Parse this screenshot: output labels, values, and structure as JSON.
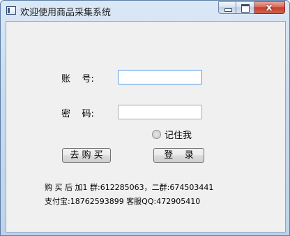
{
  "window": {
    "title": "欢迎使用商品采集系统",
    "close_glyph": "x"
  },
  "form": {
    "account_label": "账    号:",
    "account_value": "",
    "password_label": "密    码:",
    "password_value": "",
    "remember_label": "记住我",
    "remember_checked": false
  },
  "buttons": {
    "buy_label": "去 购 买",
    "login_label": "登    录"
  },
  "info": {
    "line1": "购 买 后 加1 群:612285063，二群:674503441",
    "line2": "支付宝:18762593899 客服QQ:472905410"
  },
  "colors": {
    "title_bar": "#c9dbee",
    "client_bg": "#f0f0f0",
    "focus_border": "#569de5",
    "close_button": "#c33d2b"
  }
}
